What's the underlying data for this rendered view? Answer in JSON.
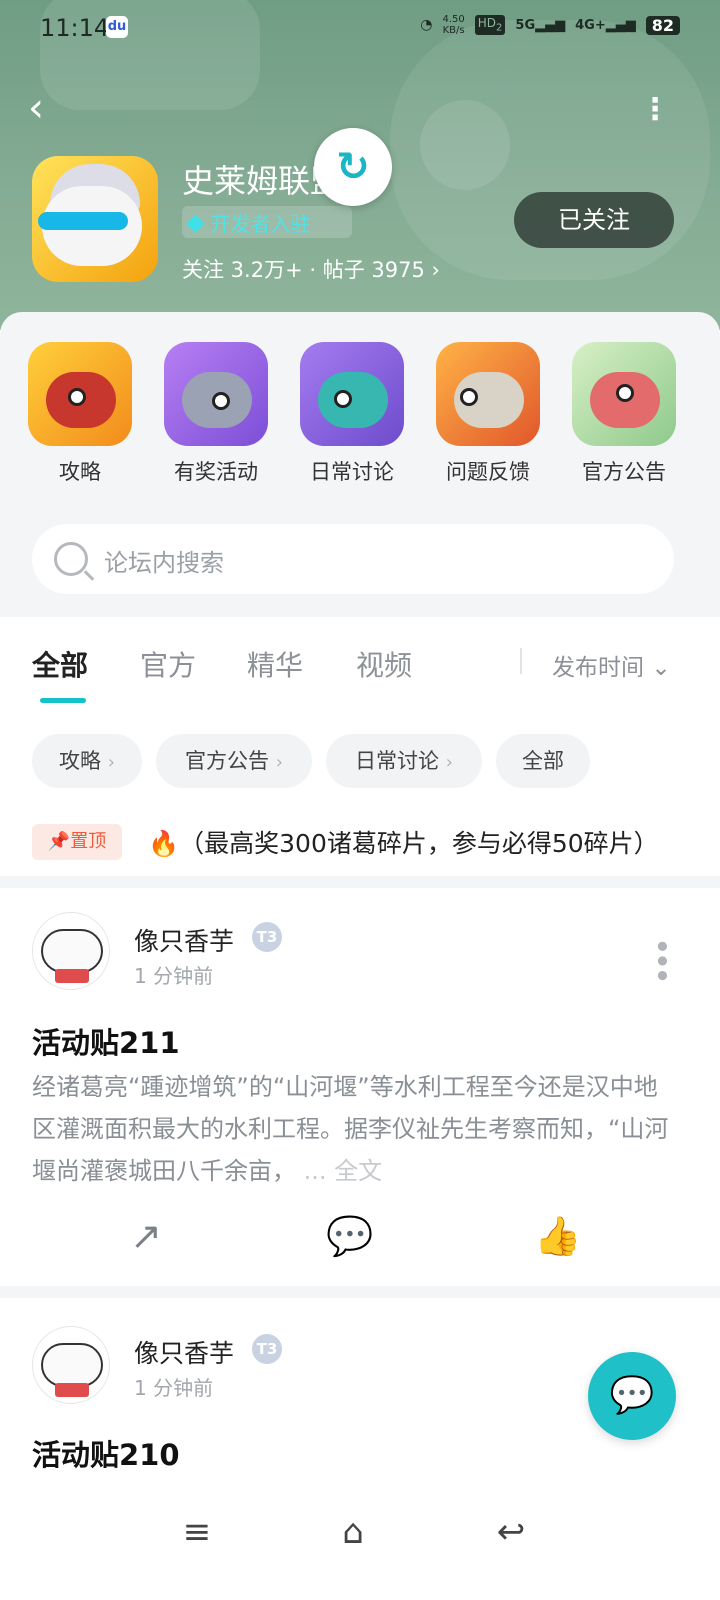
{
  "status_bar": {
    "time": "11:14",
    "baidu_icon": "baidu-app-icon",
    "net_speed_top": "4.50",
    "net_speed_bottom": "KB/s",
    "hd": "HD",
    "hd_sub": "2",
    "sig1": "5G",
    "sig2": "4G+",
    "battery": "82"
  },
  "header": {
    "game_name": "史莱姆联盟",
    "dev_badge": "开发者入驻",
    "stats": "关注 3.2万+ · 帖子 3975",
    "follow_label": "已关注",
    "colors": {
      "accent": "#16c2c9",
      "header_bg": "#84ab93"
    }
  },
  "categories": [
    {
      "label": "攻略",
      "icon": "strategy-icon"
    },
    {
      "label": "有奖活动",
      "icon": "event-icon"
    },
    {
      "label": "日常讨论",
      "icon": "discussion-icon"
    },
    {
      "label": "问题反馈",
      "icon": "feedback-icon"
    },
    {
      "label": "官方公告",
      "icon": "announcement-icon"
    }
  ],
  "search": {
    "placeholder": "论坛内搜索"
  },
  "tabs": [
    {
      "label": "全部",
      "active": true
    },
    {
      "label": "官方",
      "active": false
    },
    {
      "label": "精华",
      "active": false
    },
    {
      "label": "视频",
      "active": false
    }
  ],
  "sort_label": "发布时间",
  "chips": [
    {
      "label": "攻略",
      "arrow": "›"
    },
    {
      "label": "官方公告",
      "arrow": "›"
    },
    {
      "label": "日常讨论",
      "arrow": "›"
    },
    {
      "label": "全部",
      "arrow": ""
    }
  ],
  "pinned": {
    "badge": "置顶",
    "text": "（最高奖300诸葛碎片，参与必得50碎片）"
  },
  "posts": [
    {
      "user": "像只香芋",
      "level": "T3",
      "time": "1 分钟前",
      "title": "活动贴211",
      "body": "经诸葛亮“踵迹增筑”的“山河堰”等水利工程至今还是汉中地区灌溉面积最大的水利工程。据李仪祉先生考察而知，“山河堰尚灌褒城田八千余亩，",
      "more": "... 全文"
    },
    {
      "user": "像只香芋",
      "level": "T3",
      "time": "1 分钟前",
      "title": "活动贴210"
    }
  ]
}
